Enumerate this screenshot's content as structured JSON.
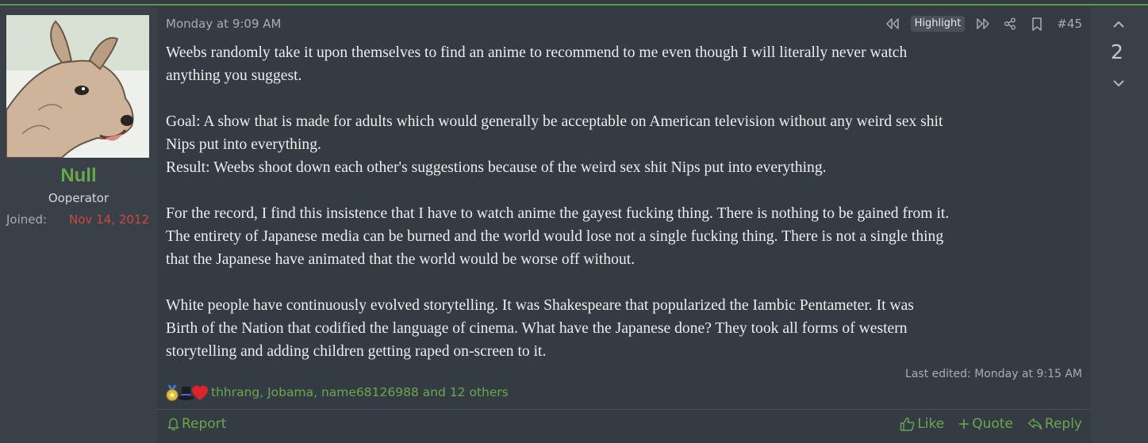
{
  "user": {
    "name": "Null",
    "title": "Ooperator",
    "joined_label": "Joined:",
    "joined_date": "Nov 14, 2012",
    "avatar_icon": "dog-avatar-icon"
  },
  "post": {
    "date": "Monday at 9:09 AM",
    "highlight_label": "Highlight",
    "number": "#45",
    "paragraphs": [
      "Weebs randomly take it upon themselves to find an anime to recommend to me even though I will literally never watch\nanything you suggest.",
      "Goal: A show that is made for adults which would generally be acceptable on American television without any weird sex shit\nNips put into everything.\nResult: Weebs shoot down each other's suggestions because of the weird sex shit Nips put into everything.",
      "For the record, I find this insistence that I have to watch anime the gayest fucking thing. There is nothing to be gained from it.\nThe entirety of Japanese media can be burned and the world would lose not a single fucking thing. There is not a single thing\nthat the Japanese have animated that the world would be worse off without.",
      "",
      "White people have continuously evolved storytelling. It was Shakespeare that popularized the Iambic Pentameter. It was\nBirth of the Nation that codified the language of cinema. What have the Japanese done? They took all forms of western\nstorytelling and adding children getting raped on-screen to it."
    ],
    "last_edited": "Last edited: Monday at 9:15 AM",
    "reactions": {
      "icons": [
        "medal-icon",
        "top-hat-icon",
        "heart-icon"
      ],
      "users_text": "thhrang, Jobama, name68126988 and 12 others"
    }
  },
  "footer": {
    "report_label": "Report",
    "like_label": "Like",
    "quote_label": "Quote",
    "reply_label": "Reply"
  },
  "vote": {
    "count": "2"
  },
  "colors": {
    "accent_green": "#68a84c",
    "joined_red": "#d4453f",
    "background": "#353b42",
    "panel": "#3a4048"
  }
}
